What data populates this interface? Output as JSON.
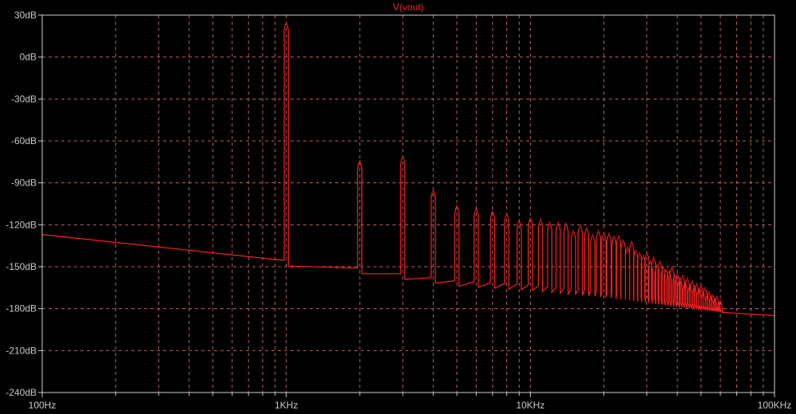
{
  "chart_data": {
    "type": "line",
    "title": "V(vout)",
    "xlabel": "",
    "ylabel": "",
    "x_scale": "log",
    "xlim": [
      100,
      100000
    ],
    "ylim": [
      -240,
      30
    ],
    "x_ticks": [
      {
        "value": 100,
        "label": "100Hz"
      },
      {
        "value": 1000,
        "label": "1KHz"
      },
      {
        "value": 10000,
        "label": "10KHz"
      },
      {
        "value": 100000,
        "label": "100KHz"
      }
    ],
    "y_ticks": [
      {
        "value": 30,
        "label": "30dB"
      },
      {
        "value": 0,
        "label": "0dB"
      },
      {
        "value": -30,
        "label": "-30dB"
      },
      {
        "value": -60,
        "label": "-60dB"
      },
      {
        "value": -90,
        "label": "-90dB"
      },
      {
        "value": -120,
        "label": "-120dB"
      },
      {
        "value": -150,
        "label": "-150dB"
      },
      {
        "value": -180,
        "label": "-180dB"
      },
      {
        "value": -210,
        "label": "-210dB"
      },
      {
        "value": -240,
        "label": "-240dB"
      }
    ],
    "grid": true,
    "colors": {
      "background": "#000000",
      "trace": "#ff2020",
      "grid": "#c06060",
      "frame": "#d0d0d0",
      "title": "#ff2020",
      "labels": "#c8c8c8"
    },
    "series": [
      {
        "name": "V(vout)",
        "noise_floor": {
          "x": [
            100,
            300,
            950,
            1050,
            2000,
            3000,
            5000,
            10000,
            20000,
            40000,
            70000,
            100000
          ],
          "y": [
            -127,
            -133,
            -145,
            -146,
            -151,
            -155,
            -160,
            -163,
            -168,
            -175,
            -180,
            -185
          ]
        },
        "peaks": {
          "x": [
            1000,
            2000,
            3000,
            4000,
            5000,
            6000,
            7000,
            8000,
            9000,
            10000,
            11000,
            12000,
            13000,
            14000,
            15000,
            16000,
            17000,
            18000,
            19000,
            20000,
            21000,
            22000,
            23000,
            24000,
            25000,
            26000,
            27000,
            28000,
            29000,
            30000,
            31000,
            32000,
            33000,
            34000,
            35000,
            36000,
            37000,
            38000,
            39000,
            40000,
            41000,
            42000,
            43000,
            44000,
            45000,
            46000,
            47000,
            48000,
            49000,
            50000,
            51000,
            52000,
            53000,
            54000,
            55000,
            56000,
            57000,
            58000,
            59000,
            60000
          ],
          "y": [
            25,
            -74,
            -71,
            -95,
            -106,
            -108,
            -110,
            -112,
            -117,
            -115,
            -116,
            -118,
            -118,
            -119,
            -124,
            -120,
            -122,
            -127,
            -124,
            -126,
            -126,
            -128,
            -128,
            -131,
            -136,
            -132,
            -138,
            -140,
            -142,
            -140,
            -146,
            -143,
            -149,
            -146,
            -150,
            -152,
            -153,
            -150,
            -156,
            -155,
            -158,
            -156,
            -161,
            -158,
            -163,
            -160,
            -164,
            -162,
            -166,
            -163,
            -168,
            -165,
            -170,
            -168,
            -171,
            -170,
            -173,
            -171,
            -175,
            -174
          ]
        }
      }
    ]
  }
}
